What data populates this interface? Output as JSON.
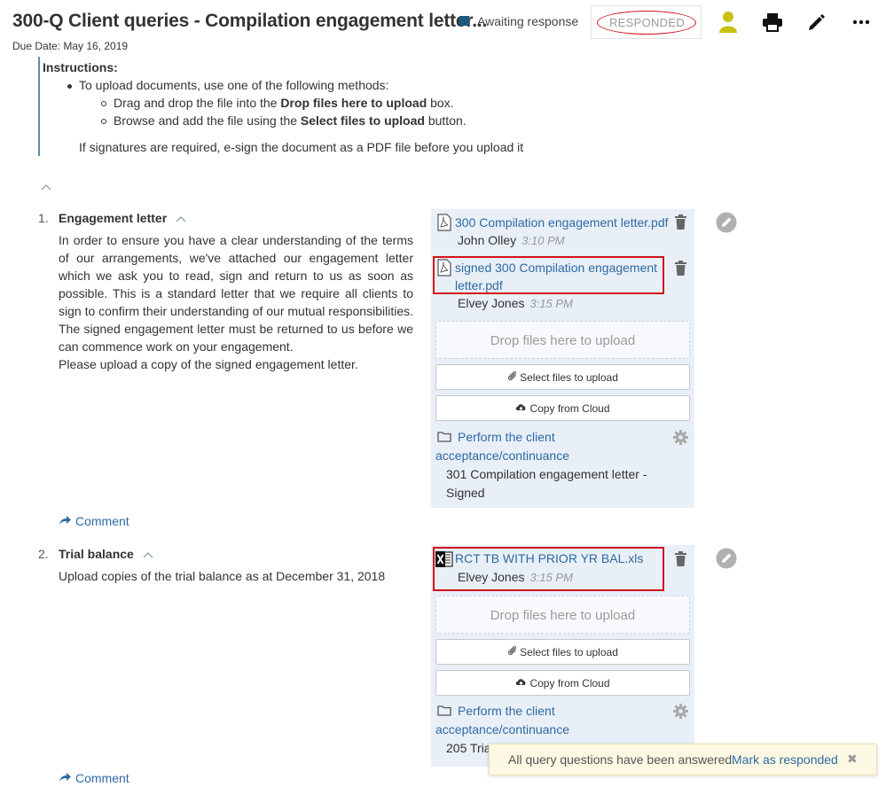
{
  "header": {
    "title": "300-Q Client queries - Compilation engagement letter...",
    "due_date": "Due Date: May 16, 2019",
    "status_label": "Awaiting response",
    "responded_label": "RESPONDED",
    "status_color": "#1b5a7d",
    "icons": [
      "user-icon",
      "print-icon",
      "edit-pencil-icon",
      "more-horizontal-icon"
    ]
  },
  "instructions": {
    "title": "Instructions:",
    "bullet": "To upload documents, use one of the following methods:",
    "sub1_a": "Drag and drop the file into the ",
    "sub1_b": "Drop files here to upload",
    "sub1_c": " box.",
    "sub2_a": "Browse and add the file using the ",
    "sub2_b": "Select files to upload",
    "sub2_c": " button.",
    "note": "If signatures are required, e-sign the document as a PDF file before you upload it"
  },
  "questions": [
    {
      "num": "1.",
      "title": "Engagement letter",
      "body": "In order to ensure you have a clear understanding of the terms of our arrangements, we've attached our engagement letter which we ask you to read, sign and return to us as soon as possible. This is a standard letter that we require all clients to sign to confirm their understanding of our mutual responsibilities. The signed engagement letter must be returned to us before we can commence work on your engagement.",
      "body2": "Please upload a copy of the signed engagement letter.",
      "files": [
        {
          "name": "300 Compilation engagement letter.pdf",
          "user": "John Olley",
          "time": "3:10 PM"
        },
        {
          "name_l1": "signed 300 Compilation engagement",
          "name_l2": "letter.pdf",
          "user": "Elvey Jones",
          "time": "3:15 PM"
        }
      ],
      "drop_label": "Drop files here to upload",
      "select_label": "Select files to upload",
      "cloud_label": "Copy from Cloud",
      "procedure_l1": "Perform the client",
      "procedure_l2": "acceptance/continuance",
      "procedure_doc_l1": "301 Compilation engagement letter -",
      "procedure_doc_l2": "Signed",
      "comment": "Comment"
    },
    {
      "num": "2.",
      "title": "Trial balance",
      "body": "Upload copies of the trial balance as at December 31, 2018",
      "files": [
        {
          "name": "RCT TB WITH PRIOR YR BAL.xls",
          "user": "Elvey Jones",
          "time": "3:15 PM"
        }
      ],
      "drop_label": "Drop files here to upload",
      "select_label": "Select files to upload",
      "cloud_label": "Copy from Cloud",
      "procedure_l1": "Perform the client",
      "procedure_l2": "acceptance/continuance",
      "procedure_doc": "205 Tria",
      "comment": "Comment"
    }
  ],
  "toast": {
    "message": "All query questions have been answered.",
    "link": "Mark as responded",
    "close": "✖"
  }
}
